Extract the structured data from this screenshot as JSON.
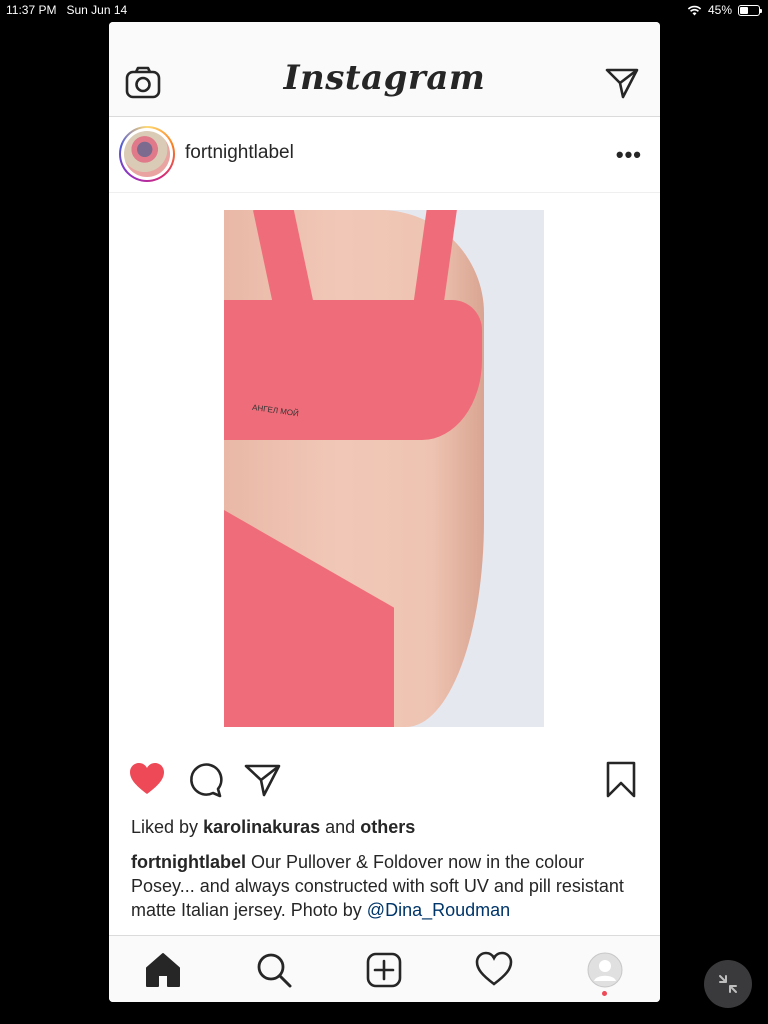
{
  "status": {
    "time": "11:37 PM",
    "date": "Sun Jun 14",
    "battery": "45%",
    "battery_level": 0.45
  },
  "header": {
    "logo": "Instagram",
    "left_icon": "camera-icon",
    "right_icon": "direct-message-icon"
  },
  "post": {
    "username": "fortnightlabel",
    "more_label": "•••",
    "photo_tattoo_text": "АНГЕЛ МОЙ",
    "liked_by_prefix": "Liked by",
    "liked_by_user": "karolinakuras",
    "liked_by_and": "and",
    "liked_by_others": "others",
    "caption_user": "fortnightlabel",
    "caption_text": " Our Pullover & Foldover now in the colour Posey... and always constructed with soft UV and pill resistant matte Italian jersey. Photo by ",
    "caption_mention": "@Dina_Roudman",
    "liked": true
  },
  "tabs": [
    {
      "icon": "home-icon",
      "active": true
    },
    {
      "icon": "search-icon"
    },
    {
      "icon": "new-post-icon"
    },
    {
      "icon": "activity-heart-icon"
    },
    {
      "icon": "profile-icon"
    }
  ],
  "colors": {
    "like_red": "#ed4956",
    "mention_blue": "#003569",
    "text": "#262626"
  }
}
